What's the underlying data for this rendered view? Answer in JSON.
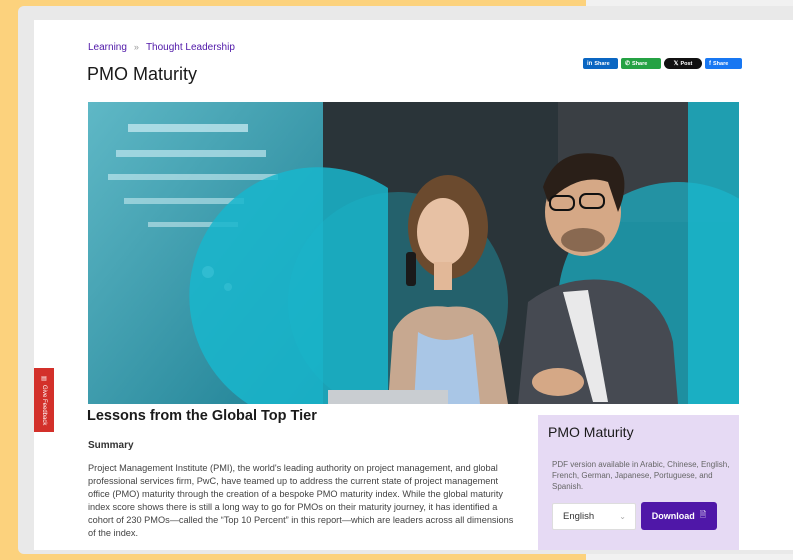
{
  "breadcrumb": {
    "items": [
      "Learning",
      "Thought Leadership"
    ],
    "separator": "»"
  },
  "page_title": "PMO Maturity",
  "share": {
    "linkedin": "Share",
    "whatsapp": "Share",
    "x": "Post",
    "facebook": "Share"
  },
  "feedback": {
    "label": "Give Feedback"
  },
  "article": {
    "heading": "Lessons from the Global Top Tier",
    "summary_heading": "Summary",
    "summary_text": "Project Management Institute (PMI), the world's leading authority on project management, and global professional services firm, PwC, have teamed up to address the current state of project management office (PMO) maturity through the creation of a bespoke PMO maturity index. While the global maturity index score shows there is still a long way to go for PMOs on their maturity journey, it has identified a cohort of 230 PMOs—called the “Top 10 Percent” in this report—which are leaders across all dimensions of the index."
  },
  "sidebar_card": {
    "title": "PMO Maturity",
    "text": "PDF version available in Arabic, Chinese, English, French, German, Japanese, Portuguese, and Spanish.",
    "language_selected": "English",
    "download_label": "Download"
  },
  "icons": {
    "linkedin": "linkedin-icon",
    "whatsapp": "whatsapp-icon",
    "x": "x-icon",
    "facebook": "facebook-icon",
    "feedback": "comment-icon",
    "chevron": "chevron-down-icon",
    "download": "pdf-icon"
  },
  "colors": {
    "brand": "#4f17a8",
    "card_bg": "#e6daf4",
    "accent_teal": "#19b6cc",
    "feedback": "#d3302a"
  }
}
